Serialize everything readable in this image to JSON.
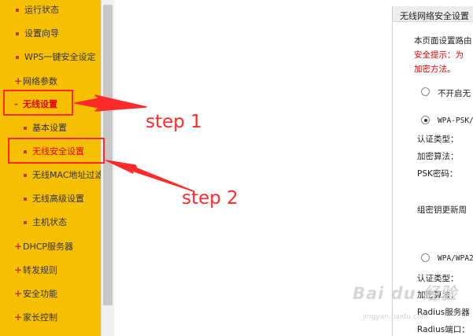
{
  "sidebar": {
    "items": [
      {
        "label": "运行状态"
      },
      {
        "label": "设置向导"
      },
      {
        "label": "WPS一键安全设定"
      },
      {
        "label": "网络参数",
        "expand": "+"
      },
      {
        "label": "无线设置",
        "expand": "-"
      },
      {
        "label": "基本设置"
      },
      {
        "label": "无线安全设置"
      },
      {
        "label": "无线MAC地址过滤"
      },
      {
        "label": "无线高级设置"
      },
      {
        "label": "主机状态"
      },
      {
        "label": "DHCP服务器",
        "expand": "+"
      },
      {
        "label": "转发规则",
        "expand": "+"
      },
      {
        "label": "安全功能",
        "expand": "+"
      },
      {
        "label": "家长控制",
        "expand": "+"
      }
    ]
  },
  "panel": {
    "title": "无线网络安全设置",
    "desc": "本页面设置路由",
    "tip_prefix": "安全提示：为",
    "tip_line2": "加密方法。",
    "opt_none": "不开启无",
    "opt_wpa_psk": "WPA-PSK/",
    "auth_type_1": "认证类型：",
    "enc_algo_1": "加密算法：",
    "psk_pwd": "PSK密码：",
    "group_key": "组密钥更新周",
    "opt_wpa": "WPA/WPA2",
    "auth_type_2": "认证类型：",
    "enc_algo_2": "加密算法：",
    "radius_server": "Radius服务器",
    "radius_port": "Radius端口："
  },
  "annotations": {
    "step1": "step 1",
    "step2": "step 2",
    "color": "#ff2a2a"
  },
  "watermark": {
    "text": "Bai du 经验",
    "url": "jingyan.baidu.com"
  }
}
